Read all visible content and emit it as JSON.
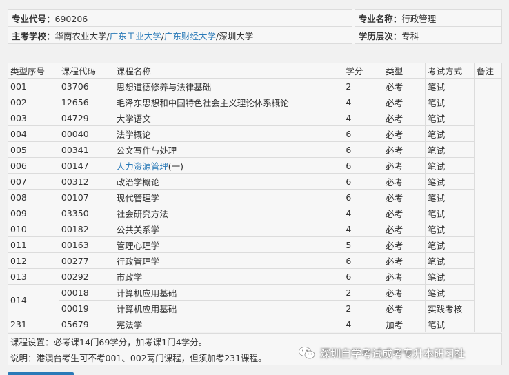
{
  "info": {
    "major_code_label": "专业代号：",
    "major_code": "690206",
    "major_name_label": "专业名称：",
    "major_name": "行政管理",
    "school_label": "主考学校：",
    "schools": [
      {
        "name": "华南农业大学",
        "link": false
      },
      {
        "name": "广东工业大学",
        "link": true
      },
      {
        "name": "广东财经大学",
        "link": true
      },
      {
        "name": "深圳大学",
        "link": false
      }
    ],
    "separator": "/",
    "level_label": "学历层次：",
    "level": "专科"
  },
  "table": {
    "headers": [
      "类型序号",
      "课程代码",
      "课程名称",
      "学分",
      "类型",
      "考试方式",
      "备注"
    ],
    "rows": [
      {
        "seq": "001",
        "code": "03706",
        "name": "思想道德修养与法律基础",
        "credit": "2",
        "type": "必考",
        "exam": "笔试"
      },
      {
        "seq": "002",
        "code": "12656",
        "name": "毛泽东思想和中国特色社会主义理论体系概论",
        "credit": "4",
        "type": "必考",
        "exam": "笔试"
      },
      {
        "seq": "003",
        "code": "04729",
        "name": "大学语文",
        "credit": "4",
        "type": "必考",
        "exam": "笔试"
      },
      {
        "seq": "004",
        "code": "00040",
        "name": "法学概论",
        "credit": "6",
        "type": "必考",
        "exam": "笔试"
      },
      {
        "seq": "005",
        "code": "00341",
        "name": "公文写作与处理",
        "credit": "6",
        "type": "必考",
        "exam": "笔试"
      },
      {
        "seq": "006",
        "code": "00147",
        "name_link": "人力资源管理",
        "name_rest": "(一)",
        "credit": "6",
        "type": "必考",
        "exam": "笔试"
      },
      {
        "seq": "007",
        "code": "00312",
        "name": "政治学概论",
        "credit": "6",
        "type": "必考",
        "exam": "笔试"
      },
      {
        "seq": "008",
        "code": "00107",
        "name": "现代管理学",
        "credit": "6",
        "type": "必考",
        "exam": "笔试"
      },
      {
        "seq": "009",
        "code": "03350",
        "name": "社会研究方法",
        "credit": "4",
        "type": "必考",
        "exam": "笔试"
      },
      {
        "seq": "010",
        "code": "00182",
        "name": "公共关系学",
        "credit": "4",
        "type": "必考",
        "exam": "笔试"
      },
      {
        "seq": "011",
        "code": "00163",
        "name": "管理心理学",
        "credit": "5",
        "type": "必考",
        "exam": "笔试"
      },
      {
        "seq": "012",
        "code": "00277",
        "name": "行政管理学",
        "credit": "6",
        "type": "必考",
        "exam": "笔试"
      },
      {
        "seq": "013",
        "code": "00292",
        "name": "市政学",
        "credit": "6",
        "type": "必考",
        "exam": "笔试"
      },
      {
        "seq": "014",
        "code": "00018",
        "name": "计算机应用基础",
        "credit": "2",
        "type": "必考",
        "exam": "笔试"
      },
      {
        "code": "00019",
        "name": "计算机应用基础",
        "credit": "2",
        "type": "必考",
        "exam": "实践考核"
      },
      {
        "seq": "231",
        "code": "05679",
        "name": "宪法学",
        "credit": "4",
        "type": "加考",
        "exam": "笔试"
      }
    ]
  },
  "footer": {
    "course_setting": "课程设置：必考课14门69学分，加考课1门4学分。",
    "note": "说明：港澳台考生可不考001、002两门课程，但须加考231课程。"
  },
  "watermark": {
    "text": "深圳自学考试成考专升本研习社",
    "icon": "wechat-icon"
  },
  "colors": {
    "link": "#2a7ab8",
    "border": "#dcdcdc",
    "cell_bg": "#f7f7f7"
  }
}
